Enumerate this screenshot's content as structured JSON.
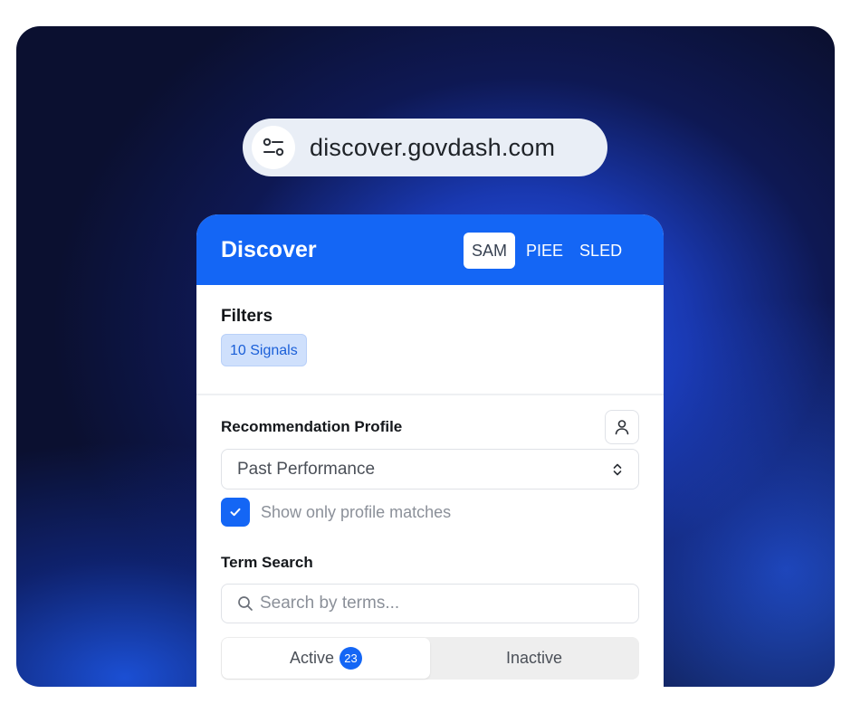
{
  "urlbar": {
    "url": "discover.govdash.com",
    "icon": "site-settings-icon"
  },
  "panel": {
    "title": "Discover",
    "sources": [
      {
        "label": "SAM",
        "active": true
      },
      {
        "label": "PIEE",
        "active": false
      },
      {
        "label": "SLED",
        "active": false
      }
    ]
  },
  "filters": {
    "title": "Filters",
    "signals_chip": "10 Signals"
  },
  "profile": {
    "title": "Recommendation Profile",
    "selected": "Past Performance",
    "checkbox_label": "Show only profile matches",
    "checkbox_checked": true
  },
  "term_search": {
    "title": "Term Search",
    "placeholder": "Search by terms..."
  },
  "status_tabs": {
    "active_label": "Active",
    "active_count": "23",
    "inactive_label": "Inactive"
  },
  "colors": {
    "brand": "#1466f5",
    "chip_bg": "#cfe0fc",
    "chip_text": "#1a5fd8"
  }
}
